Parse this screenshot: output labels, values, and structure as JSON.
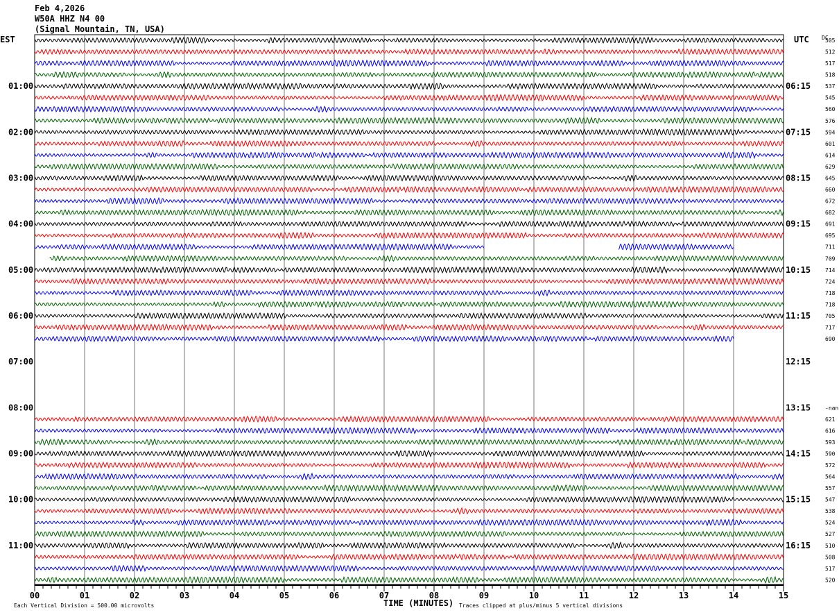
{
  "header": {
    "date": "Feb 4,2026",
    "station": "W50A HHZ N4 00",
    "location": "(Signal Mountain, TN, USA)"
  },
  "chart_data": {
    "type": "line",
    "subtype": "helicorder",
    "left_timezone": "EST",
    "right_timezone": "UTC",
    "dc_label": "DC",
    "xlabel": "TIME (MINUTES)",
    "xlim": [
      0,
      15
    ],
    "x_ticks": [
      "00",
      "01",
      "02",
      "03",
      "04",
      "05",
      "06",
      "07",
      "08",
      "09",
      "10",
      "11",
      "12",
      "13",
      "14",
      "15"
    ],
    "minutes_per_row": 15,
    "rows": 48,
    "trace_colors": [
      "#000000",
      "#ff0000",
      "#0000ff",
      "#006400"
    ],
    "left_hour_labels": [
      {
        "row": 4,
        "text": "01:00"
      },
      {
        "row": 8,
        "text": "02:00"
      },
      {
        "row": 12,
        "text": "03:00"
      },
      {
        "row": 16,
        "text": "04:00"
      },
      {
        "row": 20,
        "text": "05:00"
      },
      {
        "row": 24,
        "text": "06:00"
      },
      {
        "row": 28,
        "text": "07:00"
      },
      {
        "row": 32,
        "text": "08:00"
      },
      {
        "row": 36,
        "text": "09:00"
      },
      {
        "row": 40,
        "text": "10:00"
      },
      {
        "row": 44,
        "text": "11:00"
      }
    ],
    "right_hour_labels": [
      {
        "row": 4,
        "text": "06:15"
      },
      {
        "row": 8,
        "text": "07:15"
      },
      {
        "row": 12,
        "text": "08:15"
      },
      {
        "row": 16,
        "text": "09:15"
      },
      {
        "row": 20,
        "text": "10:15"
      },
      {
        "row": 24,
        "text": "11:15"
      },
      {
        "row": 28,
        "text": "12:15"
      },
      {
        "row": 32,
        "text": "13:15"
      },
      {
        "row": 36,
        "text": "14:15"
      },
      {
        "row": 40,
        "text": "15:15"
      },
      {
        "row": 44,
        "text": "16:15"
      }
    ],
    "dc_values": [
      {
        "row": 0,
        "text": "505"
      },
      {
        "row": 1,
        "text": "512"
      },
      {
        "row": 2,
        "text": "517"
      },
      {
        "row": 3,
        "text": "518"
      },
      {
        "row": 4,
        "text": "537"
      },
      {
        "row": 5,
        "text": "545"
      },
      {
        "row": 6,
        "text": "560"
      },
      {
        "row": 7,
        "text": "576"
      },
      {
        "row": 8,
        "text": "594"
      },
      {
        "row": 9,
        "text": "601"
      },
      {
        "row": 10,
        "text": "614"
      },
      {
        "row": 11,
        "text": "629"
      },
      {
        "row": 12,
        "text": "645"
      },
      {
        "row": 13,
        "text": "660"
      },
      {
        "row": 14,
        "text": "672"
      },
      {
        "row": 15,
        "text": "682"
      },
      {
        "row": 16,
        "text": "691"
      },
      {
        "row": 17,
        "text": "695"
      },
      {
        "row": 18,
        "text": "711"
      },
      {
        "row": 19,
        "text": "709"
      },
      {
        "row": 20,
        "text": "714"
      },
      {
        "row": 21,
        "text": "724"
      },
      {
        "row": 22,
        "text": "718"
      },
      {
        "row": 23,
        "text": "718"
      },
      {
        "row": 24,
        "text": "705"
      },
      {
        "row": 25,
        "text": "717"
      },
      {
        "row": 26,
        "text": "690"
      },
      {
        "row": 32,
        "text": "-nan"
      },
      {
        "row": 33,
        "text": "621"
      },
      {
        "row": 34,
        "text": "616"
      },
      {
        "row": 35,
        "text": "593"
      },
      {
        "row": 36,
        "text": "590"
      },
      {
        "row": 37,
        "text": "572"
      },
      {
        "row": 38,
        "text": "564"
      },
      {
        "row": 39,
        "text": "557"
      },
      {
        "row": 40,
        "text": "547"
      },
      {
        "row": 41,
        "text": "538"
      },
      {
        "row": 42,
        "text": "524"
      },
      {
        "row": 43,
        "text": "527"
      },
      {
        "row": 44,
        "text": "510"
      },
      {
        "row": 45,
        "text": "508"
      },
      {
        "row": 46,
        "text": "517"
      },
      {
        "row": 47,
        "text": "520"
      }
    ],
    "trace_segments": [
      {
        "rows": [
          0,
          17
        ],
        "start_min": 0,
        "end_min": 15
      },
      {
        "rows": [
          18,
          18
        ],
        "start_min": 0,
        "end_min": 9
      },
      {
        "rows": [
          18,
          18
        ],
        "start_min": 11.7,
        "end_min": 14
      },
      {
        "rows": [
          19,
          19
        ],
        "start_min": 0.3,
        "end_min": 15
      },
      {
        "rows": [
          20,
          25
        ],
        "start_min": 0,
        "end_min": 15
      },
      {
        "rows": [
          26,
          26
        ],
        "start_min": 0,
        "end_min": 14
      },
      {
        "rows": [
          33,
          47
        ],
        "start_min": 0,
        "end_min": 15
      }
    ]
  },
  "footer": {
    "scale_note": "Each Vertical Division =  500.00 microvolts",
    "clip_note": "Traces clipped at plus/minus 5 vertical divisions"
  }
}
